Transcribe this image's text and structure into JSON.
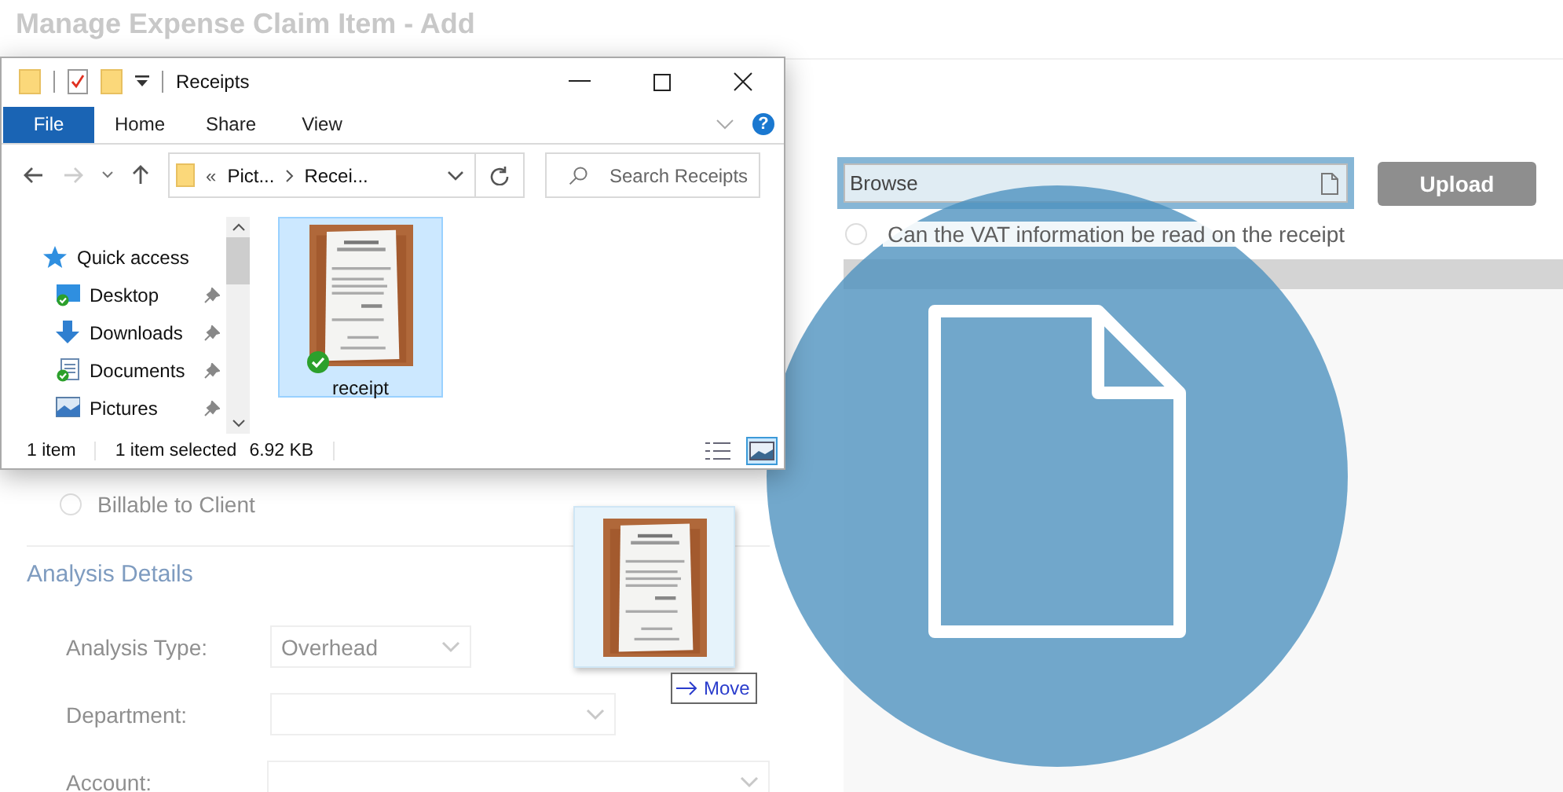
{
  "page_title": "Manage Expense Claim Item - Add",
  "upload": {
    "value": "Browse",
    "button": "Upload",
    "button_disabled": true,
    "vat": {
      "label": "Can the VAT information be read on the receipt",
      "checked": false
    }
  },
  "billable": {
    "label": "Billable to Client",
    "checked": false
  },
  "analysis": {
    "heading": "Analysis Details",
    "fields": [
      {
        "label": "Analysis Type:",
        "value": "Overhead",
        "kind": "short"
      },
      {
        "label": "Department:",
        "kind": "medium"
      },
      {
        "label": "Account:",
        "kind": "long"
      }
    ]
  },
  "explorer": {
    "title": "Receipts",
    "ribbon_tabs": [
      {
        "label": "File",
        "selected": true
      },
      {
        "label": "Home",
        "selected": false
      },
      {
        "label": "Share",
        "selected": false
      },
      {
        "label": "View",
        "selected": false
      }
    ],
    "help": "?",
    "address": {
      "overflow": "«",
      "crumbs": [
        "Pict...",
        "Recei..."
      ]
    },
    "search": {
      "placeholder": "Search Receipts"
    },
    "nav": [
      {
        "label": "Quick access",
        "kind": "star",
        "pinned": false
      },
      {
        "label": "Desktop",
        "kind": "desktop",
        "pinned": true
      },
      {
        "label": "Downloads",
        "kind": "download",
        "pinned": true
      },
      {
        "label": "Documents",
        "kind": "documents",
        "pinned": true
      },
      {
        "label": "Pictures",
        "kind": "pictures",
        "pinned": true
      }
    ],
    "files": [
      {
        "name": "receipt",
        "selected": true,
        "synced": true
      }
    ],
    "status": {
      "count": "1 item",
      "selection": "1 item selected",
      "size": "6.92 KB"
    },
    "views": [
      {
        "kind": "details",
        "selected": false
      },
      {
        "kind": "large",
        "selected": true
      }
    ]
  },
  "drag": {
    "action": "Move"
  }
}
